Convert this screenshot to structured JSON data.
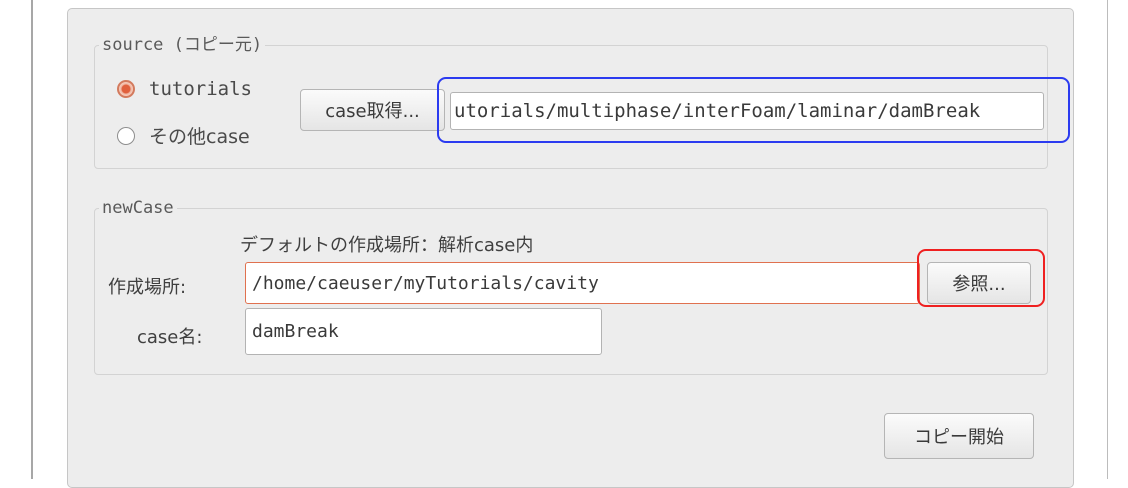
{
  "source": {
    "title": "source (コピー元)",
    "radio_tutorials": "tutorials",
    "radio_other": "その他case",
    "get_case_button": "case取得...",
    "path_value": "utorials/multiphase/interFoam/laminar/damBreak"
  },
  "new_case": {
    "title": "newCase",
    "default_note": "デフォルトの作成場所：解析case内",
    "location_label": "作成場所:",
    "location_value": "/home/caeuser/myTutorials/cavity",
    "browse_button": "参照...",
    "case_name_label": "case名:",
    "case_name_value": "damBreak"
  },
  "start_copy_button": "コピー開始",
  "colors": {
    "highlight_blue": "#2b3bf0",
    "highlight_red": "#ef2020",
    "radio_accent": "#e0603d"
  }
}
